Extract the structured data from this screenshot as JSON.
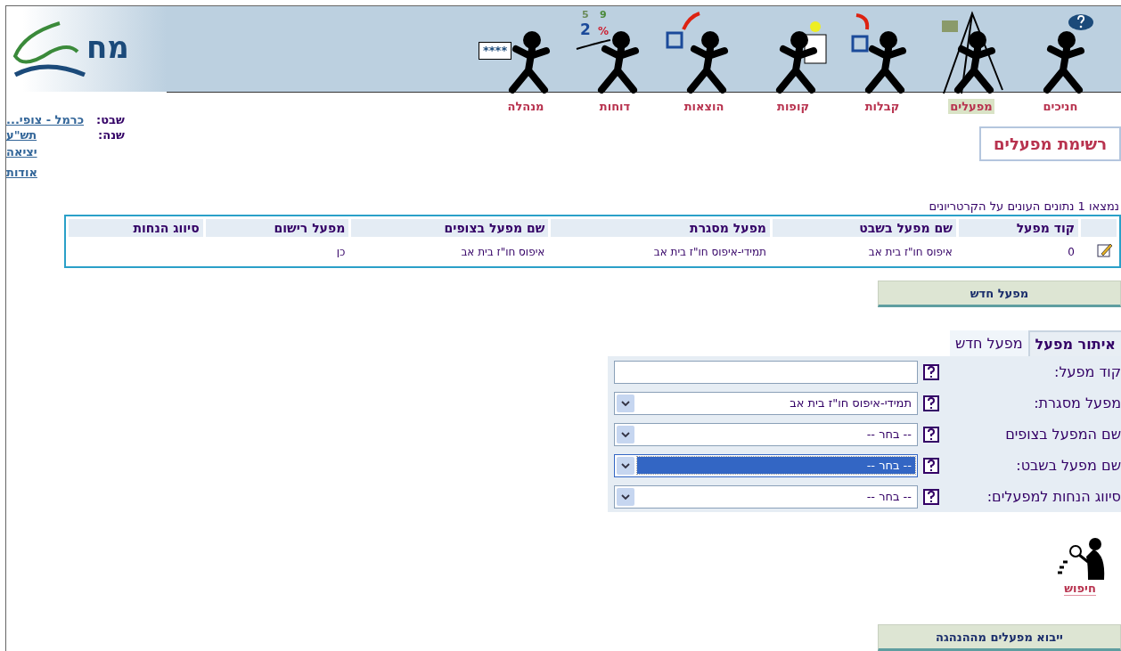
{
  "logo": {
    "text": "מח"
  },
  "nav": [
    {
      "label": "חניכים",
      "selected": false,
      "kind": "question"
    },
    {
      "label": "מפעלים",
      "selected": true,
      "kind": "flag"
    },
    {
      "label": "קבלות",
      "selected": false,
      "kind": "receive"
    },
    {
      "label": "קופות",
      "selected": false,
      "kind": "box"
    },
    {
      "label": "הוצאות",
      "selected": false,
      "kind": "send"
    },
    {
      "label": "דוחות",
      "selected": false,
      "kind": "percent",
      "marks": [
        "9",
        "5",
        "%",
        "2"
      ]
    },
    {
      "label": "מנהלה",
      "selected": false,
      "kind": "password",
      "marks": [
        "****"
      ]
    }
  ],
  "info": {
    "fields": [
      {
        "label": "שבט:",
        "value": "כרמל - צופי..."
      },
      {
        "label": "שנה:",
        "value": "תש\"ע"
      }
    ],
    "links": [
      "יציאה",
      "אודות"
    ]
  },
  "page_title": "רשימת מפעלים",
  "result_count": "נמצאו 1 נתונים העונים על הקרטריונים",
  "table": {
    "columns": [
      "קוד מפעל",
      "שם מפעל בשבט",
      "מפעל מסגרת",
      "שם מפעל בצופים",
      "מפעל רישום",
      "סיווג הנחות"
    ],
    "rows": [
      {
        "cells": [
          "0",
          "איפוס חו\"ז בית אב",
          "תמידי-איפוס חו\"ז בית אב",
          "איפוס חו\"ז בית אב",
          "כן",
          ""
        ]
      }
    ]
  },
  "new_button": "מפעל חדש",
  "tabs": [
    {
      "label": "איתור מפעל",
      "selected": true
    },
    {
      "label": "מפעל חדש",
      "selected": false
    }
  ],
  "form": [
    {
      "label": "קוד מפעל:",
      "kind": "input"
    },
    {
      "label": "מפעל מסגרת:",
      "kind": "select",
      "value": "תמידי-איפוס חו\"ז בית אב",
      "highlighted": false
    },
    {
      "label": "שם המפעל בצופים",
      "kind": "select",
      "value": "-- בחר --",
      "highlighted": false
    },
    {
      "label": "שם מפעל בשבט:",
      "kind": "select",
      "value": "-- בחר --",
      "highlighted": true
    },
    {
      "label": "סיווג הנחות למפעלים:",
      "kind": "select",
      "value": "-- בחר --",
      "highlighted": false
    }
  ],
  "search_link": "חיפוש",
  "import_button": "ייבוא מפעלים מההנהגה"
}
